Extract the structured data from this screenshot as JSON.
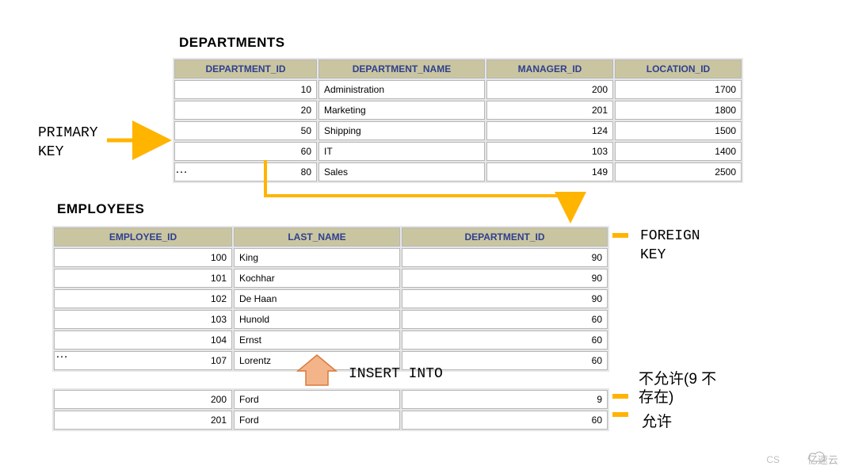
{
  "titles": {
    "departments": "DEPARTMENTS",
    "employees": "EMPLOYEES"
  },
  "labels": {
    "primary_key": "PRIMARY\nKEY",
    "foreign_key": "FOREIGN\nKEY",
    "insert_into": "INSERT INTO",
    "not_allowed": "不允许(9 不\n存在)",
    "allowed": "允许",
    "ellipsis": "…",
    "watermark": "亿速云",
    "corner": "CS"
  },
  "departments": {
    "headers": [
      "DEPARTMENT_ID",
      "DEPARTMENT_NAME",
      "MANAGER_ID",
      "LOCATION_ID"
    ],
    "rows": [
      {
        "id": "10",
        "name": "Administration",
        "mgr": "200",
        "loc": "1700"
      },
      {
        "id": "20",
        "name": "Marketing",
        "mgr": "201",
        "loc": "1800"
      },
      {
        "id": "50",
        "name": "Shipping",
        "mgr": "124",
        "loc": "1500"
      },
      {
        "id": "60",
        "name": "IT",
        "mgr": "103",
        "loc": "1400"
      },
      {
        "id": "80",
        "name": "Sales",
        "mgr": "149",
        "loc": "2500"
      }
    ]
  },
  "employees": {
    "headers": [
      "EMPLOYEE_ID",
      "LAST_NAME",
      "DEPARTMENT_ID"
    ],
    "rows": [
      {
        "id": "100",
        "name": "King",
        "dept": "90"
      },
      {
        "id": "101",
        "name": "Kochhar",
        "dept": "90"
      },
      {
        "id": "102",
        "name": "De Haan",
        "dept": "90"
      },
      {
        "id": "103",
        "name": "Hunold",
        "dept": "60"
      },
      {
        "id": "104",
        "name": "Ernst",
        "dept": "60"
      },
      {
        "id": "107",
        "name": "Lorentz",
        "dept": "60"
      }
    ]
  },
  "inserts": {
    "rows": [
      {
        "id": "200",
        "name": "Ford",
        "dept": "9"
      },
      {
        "id": "201",
        "name": "Ford",
        "dept": "60"
      }
    ]
  },
  "col_widths": {
    "dept": [
      180,
      210,
      160,
      160
    ],
    "emp": [
      225,
      210,
      260
    ]
  }
}
